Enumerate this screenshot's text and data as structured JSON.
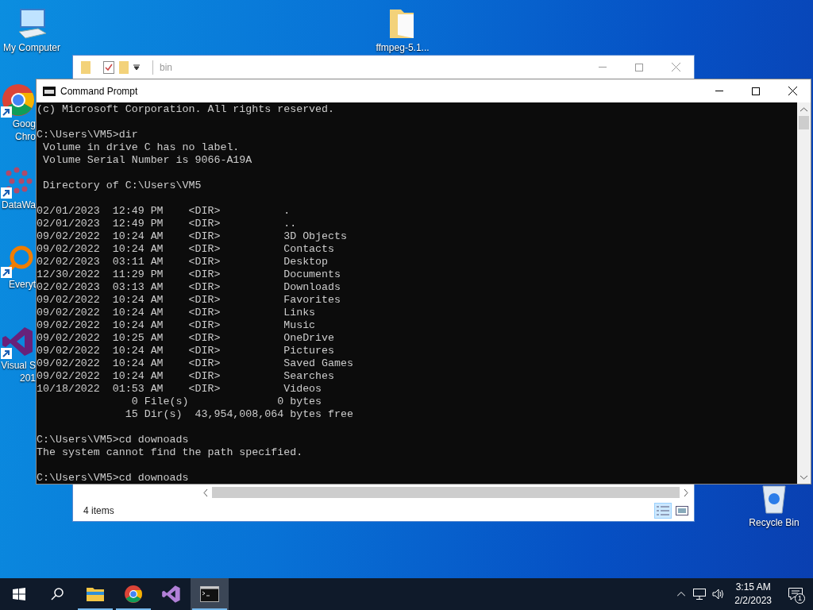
{
  "desktop": {
    "icons": [
      {
        "kind": "computer",
        "label_lines": [
          "My Computer"
        ],
        "shortcut": false
      },
      {
        "kind": "chrome",
        "label_lines": [
          "Goog",
          "Chro"
        ],
        "shortcut": true
      },
      {
        "kind": "network",
        "label_lines": [
          "DataWa"
        ],
        "shortcut": true
      },
      {
        "kind": "search",
        "label_lines": [
          "Everyt"
        ],
        "shortcut": true
      },
      {
        "kind": "studio",
        "label_lines": [
          "Visual S",
          "201"
        ],
        "shortcut": true
      },
      {
        "kind": "folder",
        "label_lines": [
          "ffmpeg-5.1..."
        ],
        "shortcut": false
      },
      {
        "kind": "recycle",
        "label_lines": [
          "Recycle Bin"
        ],
        "shortcut": false
      }
    ]
  },
  "explorer": {
    "title": "bin",
    "status": "4 items",
    "views": [
      {
        "kind": "details",
        "selected": true
      },
      {
        "kind": "preview",
        "selected": false
      }
    ]
  },
  "cmd": {
    "title": "Command Prompt",
    "blocks": [
      [
        "(c) Microsoft Corporation. All rights reserved."
      ],
      [
        "C:\\Users\\VM5>dir",
        " Volume in drive C has no label.",
        " Volume Serial Number is 9066-A19A"
      ],
      [
        " Directory of C:\\Users\\VM5"
      ],
      [
        "02/01/2023  12:49 PM    <DIR>          .",
        "02/01/2023  12:49 PM    <DIR>          ..",
        "09/02/2022  10:24 AM    <DIR>          3D Objects",
        "09/02/2022  10:24 AM    <DIR>          Contacts",
        "02/02/2023  03:11 AM    <DIR>          Desktop",
        "12/30/2022  11:29 PM    <DIR>          Documents",
        "02/02/2023  03:13 AM    <DIR>          Downloads",
        "09/02/2022  10:24 AM    <DIR>          Favorites",
        "09/02/2022  10:24 AM    <DIR>          Links",
        "09/02/2022  10:24 AM    <DIR>          Music",
        "09/02/2022  10:25 AM    <DIR>          OneDrive",
        "09/02/2022  10:24 AM    <DIR>          Pictures",
        "09/02/2022  10:24 AM    <DIR>          Saved Games",
        "09/02/2022  10:24 AM    <DIR>          Searches",
        "10/18/2022  01:53 AM    <DIR>          Videos",
        "               0 File(s)              0 bytes",
        "              15 Dir(s)  43,954,008,064 bytes free"
      ],
      [
        "C:\\Users\\VM5>cd downoads",
        "The system cannot find the path specified."
      ],
      [
        "C:\\Users\\VM5>cd downoads"
      ]
    ]
  },
  "taskbar": {
    "apps": [
      {
        "kind": "explorer",
        "open": true,
        "active": false
      },
      {
        "kind": "chrome",
        "open": true,
        "active": false
      },
      {
        "kind": "studio",
        "open": false,
        "active": false
      },
      {
        "kind": "cmd",
        "open": true,
        "active": true
      }
    ],
    "time": "3:15 AM",
    "date": "2/2/2023",
    "notifications": "1"
  }
}
